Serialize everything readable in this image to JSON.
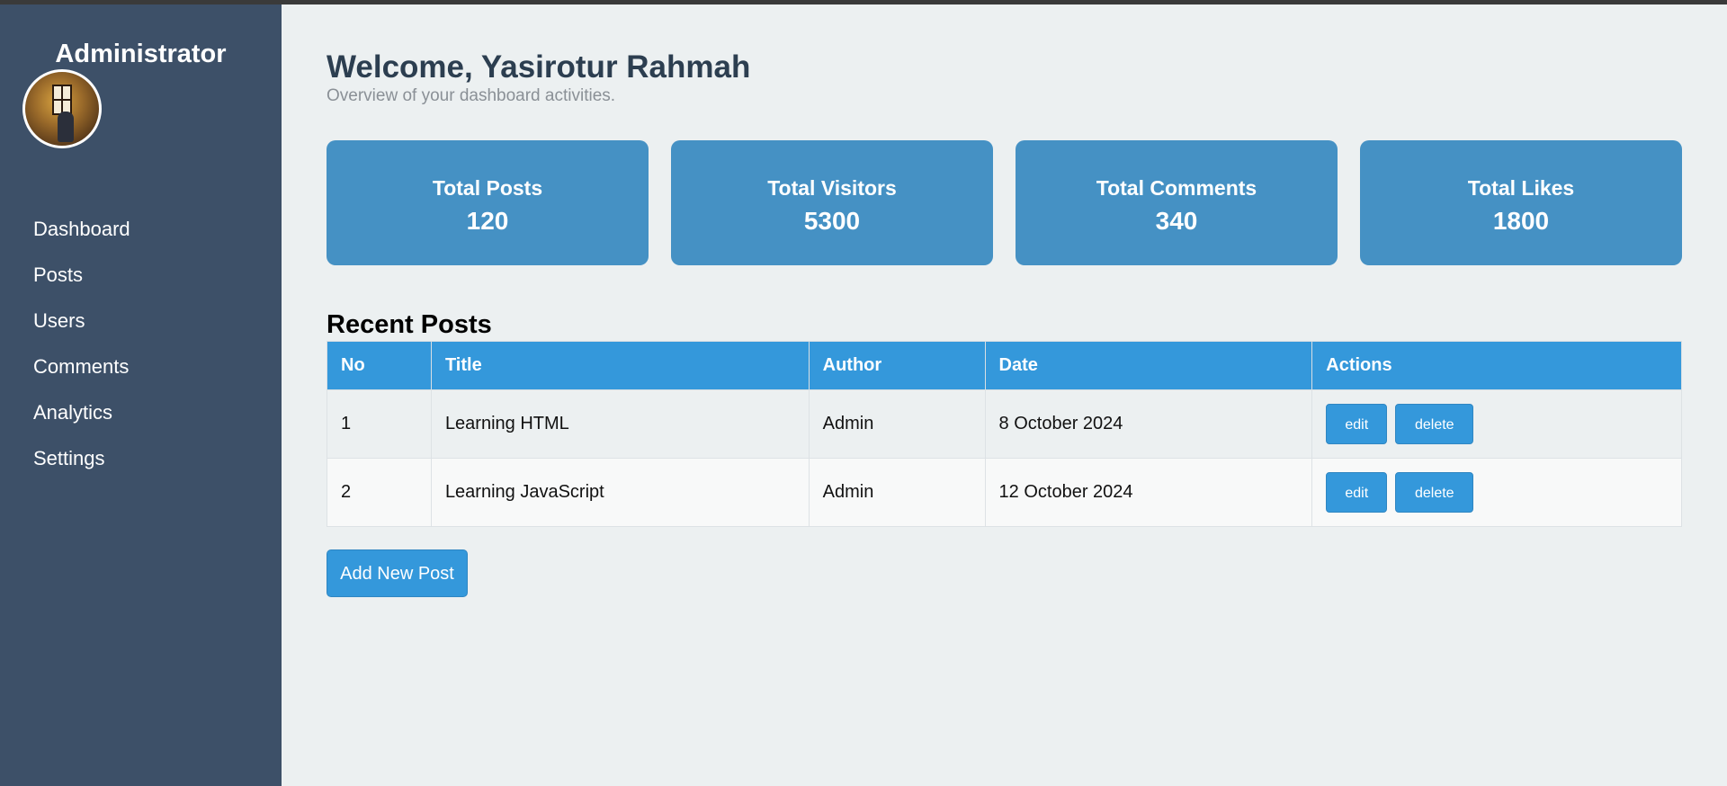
{
  "sidebar": {
    "title": "Administrator",
    "avatar_icon": "user-avatar-photo",
    "items": [
      {
        "label": "Dashboard"
      },
      {
        "label": "Posts"
      },
      {
        "label": "Users"
      },
      {
        "label": "Comments"
      },
      {
        "label": "Analytics"
      },
      {
        "label": "Settings"
      }
    ]
  },
  "header": {
    "title": "Welcome, Yasirotur Rahmah",
    "subtitle": "Overview of your dashboard activities."
  },
  "stats": [
    {
      "label": "Total Posts",
      "value": "120"
    },
    {
      "label": "Total Visitors",
      "value": "5300"
    },
    {
      "label": "Total Comments",
      "value": "340"
    },
    {
      "label": "Total Likes",
      "value": "1800"
    }
  ],
  "recent_posts": {
    "title": "Recent Posts",
    "columns": [
      "No",
      "Title",
      "Author",
      "Date",
      "Actions"
    ],
    "rows": [
      {
        "no": "1",
        "title": "Learning HTML",
        "author": "Admin",
        "date": "8 October 2024",
        "edit_label": "edit",
        "delete_label": "delete"
      },
      {
        "no": "2",
        "title": "Learning JavaScript",
        "author": "Admin",
        "date": "12 October 2024",
        "edit_label": "edit",
        "delete_label": "delete"
      }
    ],
    "add_button_label": "Add New Post"
  },
  "colors": {
    "sidebar_bg": "#3d5068",
    "page_bg": "#ecf0f1",
    "card_bg": "#4591c4",
    "accent": "#3498db",
    "heading": "#2c3e50"
  }
}
